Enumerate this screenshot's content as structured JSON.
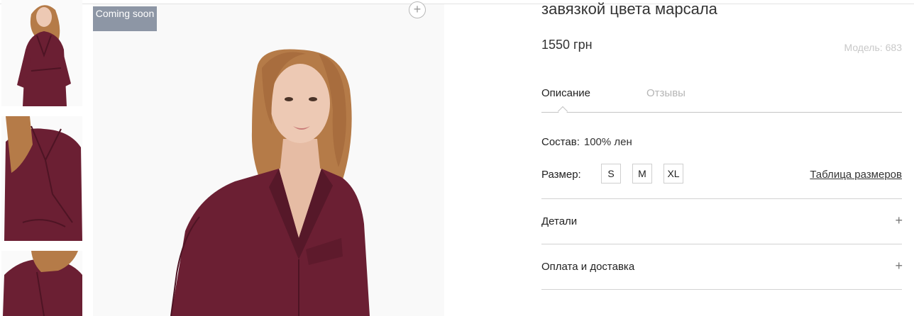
{
  "colors": {
    "garment": "#6b1f33",
    "badge": "#8d96a5",
    "hair": "#b57b48",
    "skin": "#edc9b4"
  },
  "gallery": {
    "badge_text": "Coming soon",
    "zoom_icon": "plus-circle-icon"
  },
  "product": {
    "title": "завязкой цвета марсала",
    "price": "1550 грн",
    "model_label": "Модель:",
    "model_value": "683"
  },
  "tabs": {
    "description": "Описание",
    "reviews": "Отзывы"
  },
  "composition": {
    "label": "Состав:",
    "value": "100% лен"
  },
  "sizes": {
    "label": "Размер:",
    "options": [
      "S",
      "M",
      "XL"
    ],
    "table_link": "Таблица размеров"
  },
  "accordion": {
    "details": "Детали",
    "payment": "Оплата и доставка",
    "expand_icon": "plus-icon"
  }
}
